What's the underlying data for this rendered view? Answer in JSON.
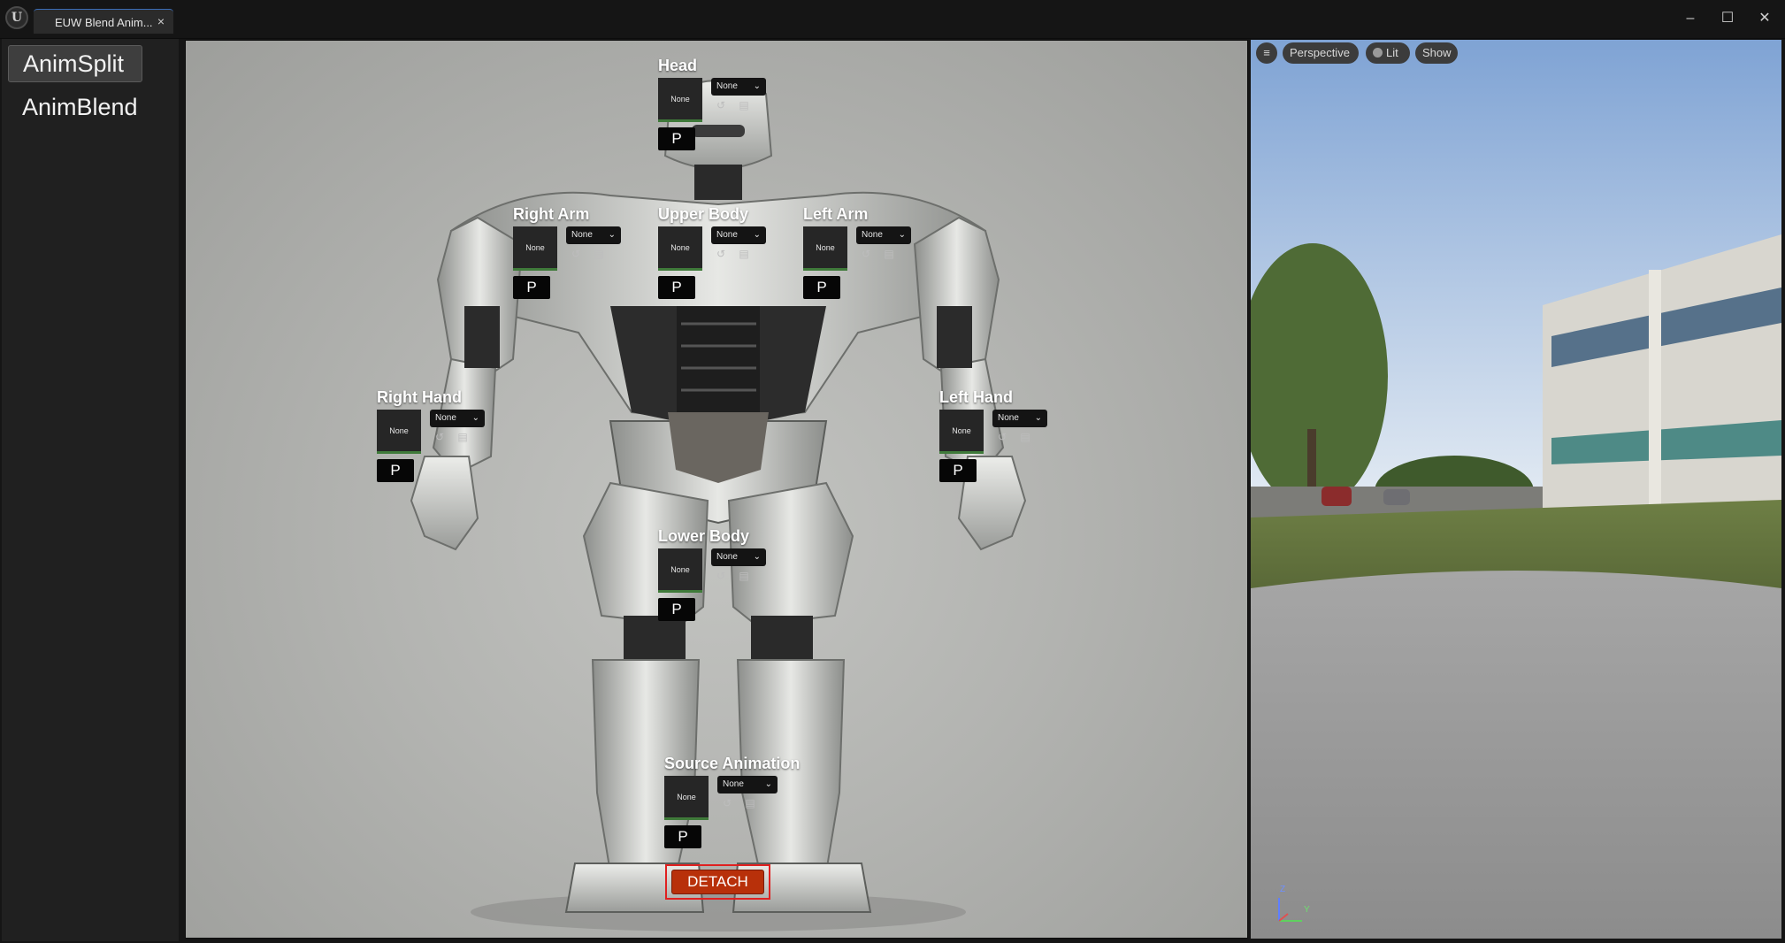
{
  "window": {
    "tab_title": "EUW Blend Anim...",
    "tab_close": "×",
    "minimize": "–",
    "maximize": "☐",
    "close": "✕"
  },
  "nav": {
    "items": [
      {
        "label": "AnimSplit"
      },
      {
        "label": "AnimBlend"
      }
    ]
  },
  "slots": [
    {
      "title": "Head",
      "thumb": "None",
      "combo": "None",
      "p": "P"
    },
    {
      "title": "Right Arm",
      "thumb": "None",
      "combo": "None",
      "p": "P"
    },
    {
      "title": "Upper Body",
      "thumb": "None",
      "combo": "None",
      "p": "P"
    },
    {
      "title": "Left Arm",
      "thumb": "None",
      "combo": "None",
      "p": "P"
    },
    {
      "title": "Right Hand",
      "thumb": "None",
      "combo": "None",
      "p": "P"
    },
    {
      "title": "Left Hand",
      "thumb": "None",
      "combo": "None",
      "p": "P"
    },
    {
      "title": "Lower Body",
      "thumb": "None",
      "combo": "None",
      "p": "P"
    },
    {
      "title": "Source Animation",
      "thumb": "None",
      "combo": "None",
      "p": "P"
    }
  ],
  "detach_label": "DETACH",
  "viewport": {
    "menu_icon": "≡",
    "perspective": "Perspective",
    "lit": "Lit",
    "show": "Show",
    "axis_z": "Z",
    "axis_y": "Y"
  }
}
